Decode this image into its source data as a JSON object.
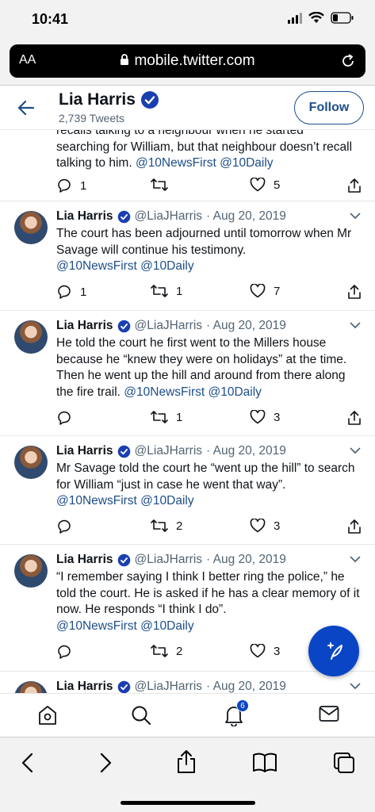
{
  "status_bar": {
    "time": "10:41"
  },
  "browser": {
    "aa_label": "AA",
    "url": "mobile.twitter.com"
  },
  "profile": {
    "name": "Lia Harris",
    "tweet_count": "2,739 Tweets",
    "follow_label": "Follow"
  },
  "tweets": [
    {
      "text_plain": "recalls talking to a neighbour when he started searching for William, but that neighbour doesn’t recall talking to him.",
      "links": "@10NewsFirst @10Daily",
      "reply_count": "1",
      "retweet_count": "",
      "like_count": "5"
    },
    {
      "name": "Lia Harris",
      "handle": "@LiaJHarris",
      "date": "· Aug 20, 2019",
      "text_plain": "The court has been adjourned until tomorrow when Mr Savage will continue his testimony.",
      "links": "@10NewsFirst @10Daily",
      "reply_count": "1",
      "retweet_count": "1",
      "like_count": "7"
    },
    {
      "name": "Lia Harris",
      "handle": "@LiaJHarris",
      "date": "· Aug 20, 2019",
      "text_plain": "He told the court he first went to the Millers house because he “knew they were on holidays” at the time. Then he went up the hill and around from there along the fire trail.",
      "links": "@10NewsFirst @10Daily",
      "reply_count": "",
      "retweet_count": "1",
      "like_count": "3"
    },
    {
      "name": "Lia Harris",
      "handle": "@LiaJHarris",
      "date": "· Aug 20, 2019",
      "text_plain": "Mr Savage told the court he “went up the hill” to search for William “just in case he went that way”.",
      "links": "@10NewsFirst @10Daily",
      "reply_count": "",
      "retweet_count": "2",
      "like_count": "3"
    },
    {
      "name": "Lia Harris",
      "handle": "@LiaJHarris",
      "date": "· Aug 20, 2019",
      "text_plain": "“I remember saying I think I better ring the police,” he told the court. He is asked if he has a clear memory of it now. He responds “I think I do”.",
      "links": "@10NewsFirst @10Daily",
      "reply_count": "",
      "retweet_count": "2",
      "like_count": "3"
    },
    {
      "name": "Lia Harris",
      "handle": "@LiaJHarris",
      "date": "· Aug 20, 2019"
    }
  ],
  "notifications_badge": "6",
  "colors": {
    "link": "#1d4e89",
    "accent": "#0a45c6",
    "verified": "#1a3fb0"
  }
}
